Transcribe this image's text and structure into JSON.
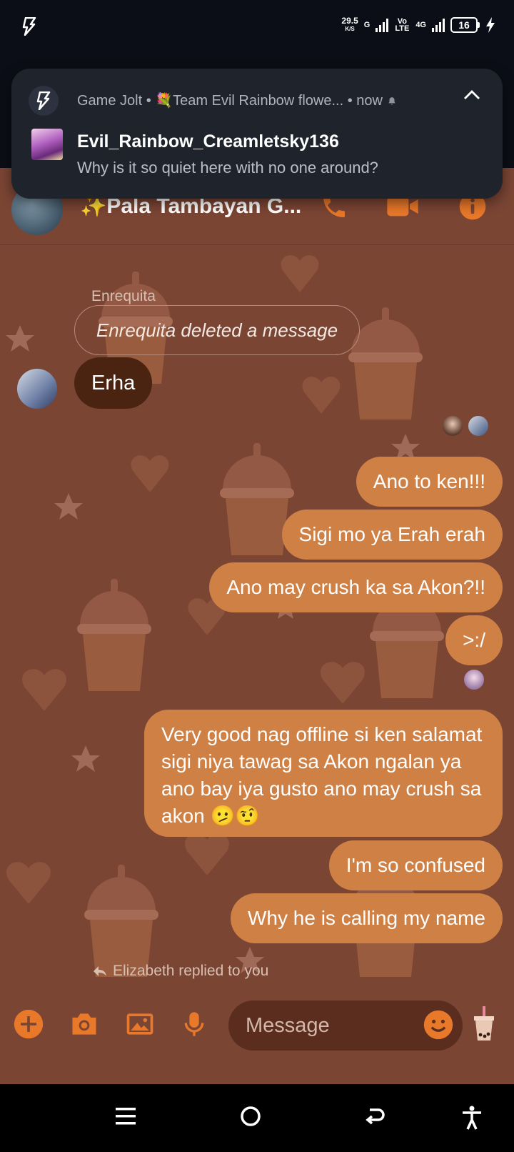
{
  "status_bar": {
    "net_speed": "29.5",
    "net_speed_unit": "K/S",
    "network_g": "G",
    "volte": "Vo LTE",
    "network_4g": "4G",
    "battery": "16",
    "icons": [
      "game-jolt-bolt-icon",
      "signal-icon",
      "battery-icon",
      "charging-icon"
    ]
  },
  "notification": {
    "app_name": "Game Jolt",
    "channel": "💐Team Evil Rainbow flowe...",
    "time": "now",
    "sender": "Evil_Rainbow_Creamletsky136",
    "message": "Why is it so quiet here with no one around?"
  },
  "header": {
    "title": "✨Pala Tambayan G...",
    "accent_color": "#e8782a"
  },
  "messages": {
    "sender_name": "Enrequita",
    "deleted_text": "Enrequita deleted a message",
    "incoming": "Erha",
    "outgoing": [
      "Ano to ken!!!",
      "Sigi mo ya Erah erah",
      "Ano may crush ka sa Akon?!!",
      ">:/",
      "Very good nag offline si ken salamat sigi niya tawag sa Akon ngalan ya ano bay iya gusto ano may crush sa akon 🫤🤨",
      "I'm so confused",
      "Why he is calling my name"
    ],
    "reply_note": "Elizabeth replied to you"
  },
  "composer": {
    "placeholder": "Message"
  },
  "theme": {
    "background": "#7b4534",
    "bubble_outgoing": "#cf8045",
    "bubble_incoming": "#4a2410"
  }
}
